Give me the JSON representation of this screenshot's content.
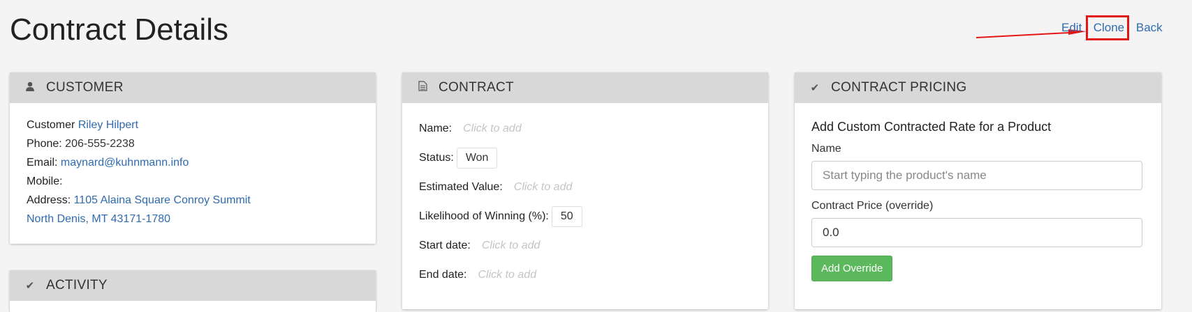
{
  "page": {
    "title": "Contract Details"
  },
  "actions": {
    "edit": "Edit",
    "clone": "Clone",
    "back": "Back",
    "separator": "|"
  },
  "customer": {
    "header": "CUSTOMER",
    "icon": "user-icon",
    "customer_label": "Customer",
    "customer_name": "Riley Hilpert",
    "phone_label": "Phone:",
    "phone": "206-555-2238",
    "email_label": "Email:",
    "email": "maynard@kuhnmann.info",
    "mobile_label": "Mobile:",
    "address_label": "Address:",
    "address_line1": "1105 Alaina Square Conroy Summit",
    "address_line2": "North Denis, MT 43171-1780"
  },
  "activity": {
    "header": "ACTIVITY",
    "icon": "check-icon"
  },
  "contract": {
    "header": "CONTRACT",
    "icon": "document-icon",
    "name_label": "Name:",
    "name_placeholder": "Click to add",
    "status_label": "Status:",
    "status": "Won",
    "estimated_value_label": "Estimated Value:",
    "estimated_value_placeholder": "Click to add",
    "likelihood_label": "Likelihood of Winning (%):",
    "likelihood": "50",
    "start_date_label": "Start date:",
    "start_date_placeholder": "Click to add",
    "end_date_label": "End date:",
    "end_date_placeholder": "Click to add"
  },
  "pricing": {
    "header": "CONTRACT PRICING",
    "icon": "check-icon",
    "form_title": "Add Custom Contracted Rate for a Product",
    "name_label": "Name",
    "name_placeholder": "Start typing the product's name",
    "price_label": "Contract Price (override)",
    "price_value": "0.0",
    "add_button": "Add Override"
  },
  "colors": {
    "link": "#2f6bb0",
    "highlight": "#e31616",
    "button": "#5cb85c",
    "panel_header": "#d8d8d8"
  }
}
